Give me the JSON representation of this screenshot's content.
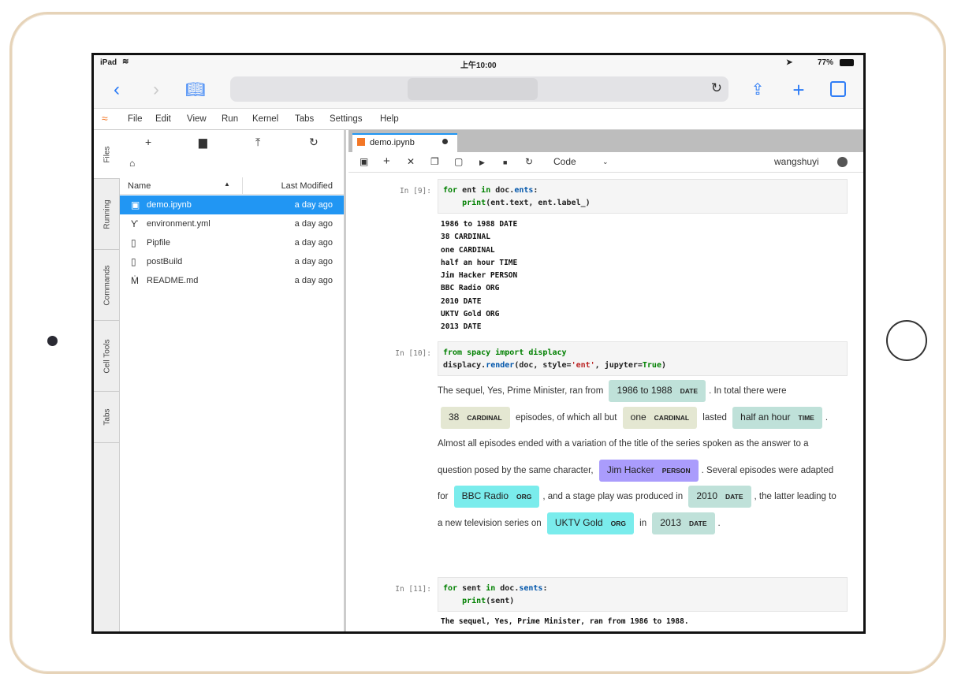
{
  "status": {
    "device": "iPad",
    "time": "上午10:00",
    "battery": "77%"
  },
  "safari": {
    "icons": [
      "chevron-left-icon",
      "chevron-right-icon",
      "book-icon",
      "reload-icon",
      "share-icon",
      "plus-icon",
      "tabs-icon"
    ]
  },
  "menu": {
    "items": [
      "File",
      "Edit",
      "View",
      "Run",
      "Kernel",
      "Tabs",
      "Settings",
      "Help"
    ]
  },
  "left_tabs": [
    "Files",
    "Running",
    "Commands",
    "Cell Tools",
    "Tabs"
  ],
  "file_browser": {
    "columns": {
      "name": "Name",
      "modified": "Last Modified"
    },
    "files": [
      {
        "name": "demo.ipynb",
        "modified": "a day ago",
        "icon": "notebook-icon",
        "selected": true
      },
      {
        "name": "environment.yml",
        "modified": "a day ago",
        "icon": "yaml-icon"
      },
      {
        "name": "Pipfile",
        "modified": "a day ago",
        "icon": "file-icon"
      },
      {
        "name": "postBuild",
        "modified": "a day ago",
        "icon": "file-icon"
      },
      {
        "name": "README.md",
        "modified": "a day ago",
        "icon": "markdown-icon"
      }
    ]
  },
  "notebook": {
    "tab": "demo.ipynb",
    "cell_type": "Code",
    "user": "wangshuyi",
    "cells": [
      {
        "prompt": "In [9]:",
        "code1a": "for",
        "code1b": " ent ",
        "code1c": "in",
        "code1d": " doc.",
        "code1e": "ents",
        ":": ":",
        "code2a": "    print",
        "code2b": "(ent.text, ent.label_)",
        "output": "1986 to 1988 DATE\n38 CARDINAL\none CARDINAL\nhalf an hour TIME\nJim Hacker PERSON\nBBC Radio ORG\n2010 DATE\nUKTV Gold ORG\n2013 DATE"
      },
      {
        "prompt": "In [10]:",
        "code1": "from spacy import displacy",
        "code2a": "displacy.",
        "code2b": "render",
        "code2c": "(doc, style=",
        "code2d": "'ent'",
        "code2e": ", jupyter=",
        "code2f": "True",
        ")": ")"
      },
      {
        "prompt": "In [11]:",
        "code1a": "for",
        "code1b": " sent ",
        "code1c": "in",
        "code1d": " doc.",
        "code1e": "sents",
        ":": ":",
        "code2a": "    print",
        "code2b": "(sent)",
        "output": "The sequel, Yes, Prime Minister, ran from 1986 to 1988."
      }
    ],
    "displacy": [
      {
        "t": "The sequel, Yes, Prime Minister, ran from "
      },
      {
        "e": "1986 to 1988",
        "l": "DATE"
      },
      {
        "t": ". In total there were "
      },
      {
        "e": "38",
        "l": "CARDINAL"
      },
      {
        "t": " episodes, of which all but "
      },
      {
        "e": "one",
        "l": "CARDINAL"
      },
      {
        "t": " lasted "
      },
      {
        "e": "half an hour",
        "l": "TIME"
      },
      {
        "t": ". Almost all episodes ended with a variation of the title of the series spoken as the answer to a question posed by the same character, "
      },
      {
        "e": "Jim Hacker",
        "l": "PERSON"
      },
      {
        "t": ". Several episodes were adapted for "
      },
      {
        "e": "BBC Radio",
        "l": "ORG"
      },
      {
        "t": ", and a stage play was produced in "
      },
      {
        "e": "2010",
        "l": "DATE"
      },
      {
        "t": ", the latter leading to a new television series on "
      },
      {
        "e": "UKTV Gold",
        "l": "ORG"
      },
      {
        "t": " in "
      },
      {
        "e": "2013",
        "l": "DATE"
      },
      {
        "t": "."
      }
    ]
  },
  "colors": {
    "DATE": "#bfe1d9",
    "CARDINAL": "#e4e7d2",
    "TIME": "#bfe1d9",
    "PERSON": "#aa9cfc",
    "ORG": "#7aecec",
    "selected": "#2196f3",
    "accent": "#2f7df6"
  }
}
